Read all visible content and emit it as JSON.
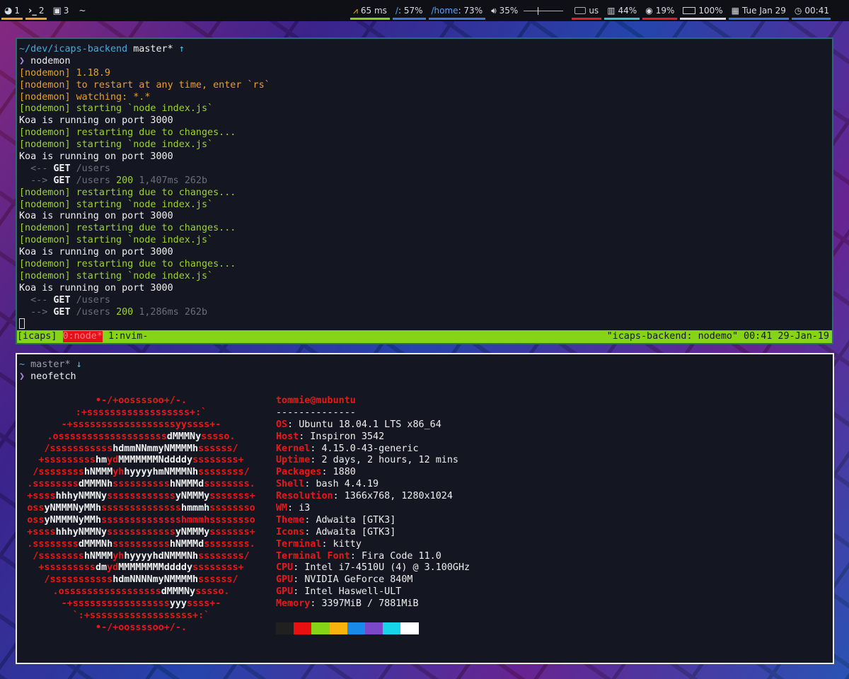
{
  "topbar": {
    "workspaces": [
      {
        "num": "1",
        "icon": "firefox-icon",
        "glyph": "◕",
        "active": true
      },
      {
        "num": "2",
        "icon": "terminal-icon",
        "glyph": "›_",
        "active": true
      },
      {
        "num": "3",
        "icon": "briefcase-icon",
        "glyph": "▣",
        "active": false
      }
    ],
    "tilde": "~",
    "widgets": {
      "ping": {
        "text": "65 ms",
        "color": "#f0c020",
        "line": "#88cc22"
      },
      "root_fs": {
        "prefix": "/",
        "text": ": 57%",
        "line": "#3a78e0"
      },
      "home_fs": {
        "prefix": "/home",
        "text": ": 73%",
        "line": "#3a78e0"
      },
      "volume": {
        "text": "35%",
        "level": 0.35
      },
      "keyboard": {
        "text": "us",
        "line": "#e02030"
      },
      "memory": {
        "text": "44%",
        "line": "#40c0c8"
      },
      "cpu": {
        "text": "19%",
        "line": "#e02030"
      },
      "battery": {
        "text": "100%",
        "line": "#d8d8d8"
      },
      "date": {
        "text": "Tue Jan 29",
        "line": "#3a78e0"
      },
      "time": {
        "text": "00:41",
        "line": "#3a78e0"
      }
    }
  },
  "term1": {
    "prompt_path": "~/dev/icaps-backend",
    "prompt_branch": "master*",
    "prompt_arrow": "↑",
    "prompt_char": "❯",
    "command": "nodemon",
    "lines": [
      {
        "text": "[nodemon] 1.18.9",
        "cls": "orange"
      },
      {
        "text": "[nodemon] to restart at any time, enter `rs`",
        "cls": "orange"
      },
      {
        "text": "[nodemon] watching: *.*",
        "cls": "orange"
      },
      {
        "text": "[nodemon] starting `node index.js`",
        "cls": "green"
      },
      {
        "text": "Koa is running on port 3000",
        "cls": "white"
      },
      {
        "text": "[nodemon] restarting due to changes...",
        "cls": "green"
      },
      {
        "text": "[nodemon] starting `node index.js`",
        "cls": "green"
      },
      {
        "text": "Koa is running on port 3000",
        "cls": "white"
      },
      {
        "req": true,
        "arrow": "  <--",
        "method": "GET",
        "path": "/users",
        "status": "",
        "time": "",
        "size": ""
      },
      {
        "req": true,
        "arrow": "  -->",
        "method": "GET",
        "path": "/users",
        "status": "200",
        "time": "1,407ms",
        "size": "262b"
      },
      {
        "text": "[nodemon] restarting due to changes...",
        "cls": "green"
      },
      {
        "text": "[nodemon] starting `node index.js`",
        "cls": "green"
      },
      {
        "text": "Koa is running on port 3000",
        "cls": "white"
      },
      {
        "text": "[nodemon] restarting due to changes...",
        "cls": "green"
      },
      {
        "text": "[nodemon] starting `node index.js`",
        "cls": "green"
      },
      {
        "text": "Koa is running on port 3000",
        "cls": "white"
      },
      {
        "text": "[nodemon] restarting due to changes...",
        "cls": "green"
      },
      {
        "text": "[nodemon] starting `node index.js`",
        "cls": "green"
      },
      {
        "text": "Koa is running on port 3000",
        "cls": "white"
      },
      {
        "req": true,
        "arrow": "  <--",
        "method": "GET",
        "path": "/users",
        "status": "",
        "time": "",
        "size": ""
      },
      {
        "req": true,
        "arrow": "  -->",
        "method": "GET",
        "path": "/users",
        "status": "200",
        "time": "1,286ms",
        "size": "262b"
      }
    ],
    "tmux": {
      "session": "[icaps]",
      "current_window": "0:node*",
      "other_window": "1:nvim-",
      "status_right": "\"icaps-backend: nodemo\" 00:41 29-Jan-19"
    }
  },
  "term2": {
    "prompt_path": "~",
    "prompt_branch": "master*",
    "prompt_arrow": "↓",
    "prompt_char": "❯",
    "command": "neofetch",
    "logo": [
      [
        [
          "r",
          "•-/+oossssoo+/-."
        ]
      ],
      [
        [
          "r",
          ":+ssssssssssssssssss+:`"
        ]
      ],
      [
        [
          "r",
          "-+ssssssssssssssssssyyssss+-"
        ]
      ],
      [
        [
          "r",
          ".osssssssssssssssssss"
        ],
        [
          "w",
          "dMMMNy"
        ],
        [
          "r",
          "sssso."
        ]
      ],
      [
        [
          "r",
          "/sssssssssss"
        ],
        [
          "w",
          "hdmmNNmmyNMMMMh"
        ],
        [
          "r",
          "ssssss/"
        ]
      ],
      [
        [
          "r",
          "+sssssssss"
        ],
        [
          "w",
          "hm"
        ],
        [
          "r",
          "yd"
        ],
        [
          "w",
          "MMMMMMMNddddy"
        ],
        [
          "r",
          "ssssssss+"
        ]
      ],
      [
        [
          "r",
          "/ssssssss"
        ],
        [
          "w",
          "hNMMM"
        ],
        [
          "r",
          "yh"
        ],
        [
          "w",
          "hyyyyhmNMMMNh"
        ],
        [
          "r",
          "ssssssss/"
        ]
      ],
      [
        [
          "r",
          ".ssssssss"
        ],
        [
          "w",
          "dMMMNh"
        ],
        [
          "r",
          "ssssssssss"
        ],
        [
          "w",
          "hNMMMd"
        ],
        [
          "r",
          "ssssssss."
        ]
      ],
      [
        [
          "r",
          "+ssss"
        ],
        [
          "w",
          "hhhyNMMNy"
        ],
        [
          "r",
          "ssssssssssss"
        ],
        [
          "w",
          "yNMMMy"
        ],
        [
          "r",
          "sssssss+"
        ]
      ],
      [
        [
          "r",
          "oss"
        ],
        [
          "w",
          "yNMMMNyMMh"
        ],
        [
          "r",
          "ssssssssssssss"
        ],
        [
          "w",
          "hmmmh"
        ],
        [
          "r",
          "ssssssso"
        ]
      ],
      [
        [
          "r",
          "oss"
        ],
        [
          "w",
          "yNMMMNyMMh"
        ],
        [
          "r",
          "sssssssssssssshmmmhssssssso"
        ]
      ],
      [
        [
          "r",
          "+ssss"
        ],
        [
          "w",
          "hhhyNMMNy"
        ],
        [
          "r",
          "ssssssssssss"
        ],
        [
          "w",
          "yNMMMy"
        ],
        [
          "r",
          "sssssss+"
        ]
      ],
      [
        [
          "r",
          ".ssssssss"
        ],
        [
          "w",
          "dMMMNh"
        ],
        [
          "r",
          "ssssssssss"
        ],
        [
          "w",
          "hNMMMd"
        ],
        [
          "r",
          "ssssssss."
        ]
      ],
      [
        [
          "r",
          "/ssssssss"
        ],
        [
          "w",
          "hNMMM"
        ],
        [
          "r",
          "yh"
        ],
        [
          "w",
          "hyyyyhdNMMMNh"
        ],
        [
          "r",
          "ssssssss/"
        ]
      ],
      [
        [
          "r",
          "+sssssssss"
        ],
        [
          "w",
          "dm"
        ],
        [
          "r",
          "yd"
        ],
        [
          "w",
          "MMMMMMMMddddy"
        ],
        [
          "r",
          "ssssssss+"
        ]
      ],
      [
        [
          "r",
          "/sssssssssss"
        ],
        [
          "w",
          "hdmNNNNmyNMMMMh"
        ],
        [
          "r",
          "ssssss/"
        ]
      ],
      [
        [
          "r",
          ".osssssssssssssssss"
        ],
        [
          "w",
          "dMMMNy"
        ],
        [
          "r",
          "sssso."
        ]
      ],
      [
        [
          "r",
          "-+sssssssssssssssss"
        ],
        [
          "w",
          "yyy"
        ],
        [
          "r",
          "ssss+-"
        ]
      ],
      [
        [
          "r",
          "`:+ssssssssssssssssss+:`"
        ]
      ],
      [
        [
          "r",
          "•-/+oossssoo+/-."
        ]
      ]
    ],
    "user_host": "tommie@mubuntu",
    "separator": "--------------",
    "info": [
      {
        "label": "OS",
        "value": "Ubuntu 18.04.1 LTS x86_64"
      },
      {
        "label": "Host",
        "value": "Inspiron 3542"
      },
      {
        "label": "Kernel",
        "value": "4.15.0-43-generic"
      },
      {
        "label": "Uptime",
        "value": "2 days, 2 hours, 12 mins"
      },
      {
        "label": "Packages",
        "value": "1880"
      },
      {
        "label": "Shell",
        "value": "bash 4.4.19"
      },
      {
        "label": "Resolution",
        "value": "1366x768, 1280x1024"
      },
      {
        "label": "WM",
        "value": "i3"
      },
      {
        "label": "Theme",
        "value": "Adwaita [GTK3]"
      },
      {
        "label": "Icons",
        "value": "Adwaita [GTK3]"
      },
      {
        "label": "Terminal",
        "value": "kitty"
      },
      {
        "label": "Terminal Font",
        "value": "Fira Code 11.0"
      },
      {
        "label": "CPU",
        "value": "Intel i7-4510U (4) @ 3.100GHz"
      },
      {
        "label": "GPU",
        "value": "NVIDIA GeForce 840M"
      },
      {
        "label": "GPU",
        "value": "Intel Haswell-ULT"
      },
      {
        "label": "Memory",
        "value": "3397MiB / 7881MiB"
      }
    ],
    "palette": [
      "#202020",
      "#e81010",
      "#86d418",
      "#f8b40c",
      "#1a8ae8",
      "#7a48c8",
      "#18d4e8",
      "#ffffff"
    ]
  }
}
